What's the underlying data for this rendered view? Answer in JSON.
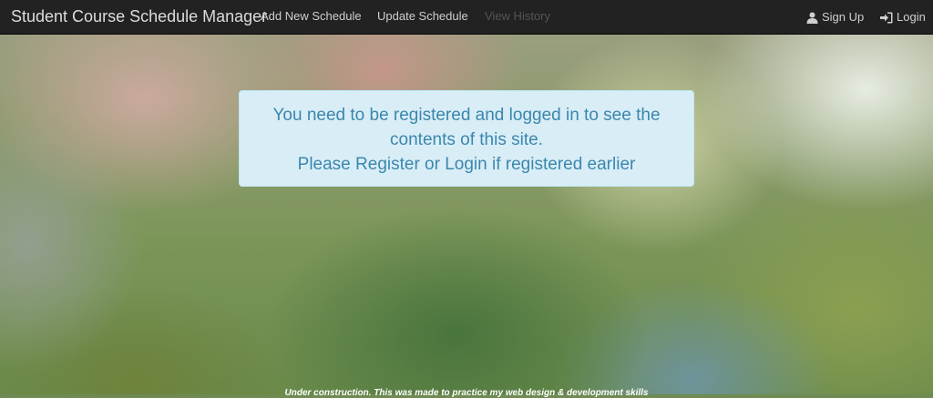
{
  "navbar": {
    "brand": "Student Course Schedule Manager",
    "links": [
      {
        "label": "Add New Schedule"
      },
      {
        "label": "Update Schedule"
      },
      {
        "label": "View History"
      }
    ],
    "signup_label": "Sign Up",
    "login_label": "Login",
    "signup_icon": "user-icon",
    "login_icon": "log-in-icon"
  },
  "alert": {
    "line1": "You need to be registered and logged in to see the contents of this site.",
    "line2": "Please Register or Login if registered earlier"
  },
  "footer": {
    "text": "Under construction. This was made to practice my web design & development skills"
  },
  "colors": {
    "navbar": "#222222",
    "alert_bg": "#d9edf7",
    "alert_text": "#3a87ad"
  }
}
